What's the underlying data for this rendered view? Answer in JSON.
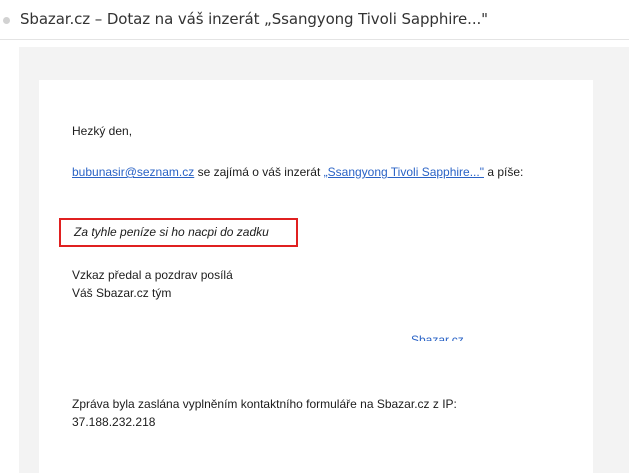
{
  "header": {
    "title": "Sbazar.cz – Dotaz na váš inzerát „Ssangyong Tivoli Sapphire...\""
  },
  "email": {
    "greeting": "Hezký den,",
    "sender_email": "bubunasir@seznam.cz",
    "intro_middle": " se zajímá o váš inzerát ",
    "listing_link": "„Ssangyong Tivoli Sapphire...\"",
    "intro_end": " a píše:",
    "message": "Za tyhle peníze si ho nacpi do zadku",
    "signoff": "Vzkaz předal a pozdrav posílá",
    "signature": "Váš Sbazar.cz tým",
    "site_link": "Sbazar.cz",
    "footer_line1": "Zpráva byla zaslána vyplněním kontaktního formuláře na Sbazar.cz z IP:",
    "footer_ip": "37.188.232.218"
  },
  "colors": {
    "link": "#2a63c6",
    "highlight_border": "#e02020",
    "outer_background": "#f3f3f3"
  }
}
